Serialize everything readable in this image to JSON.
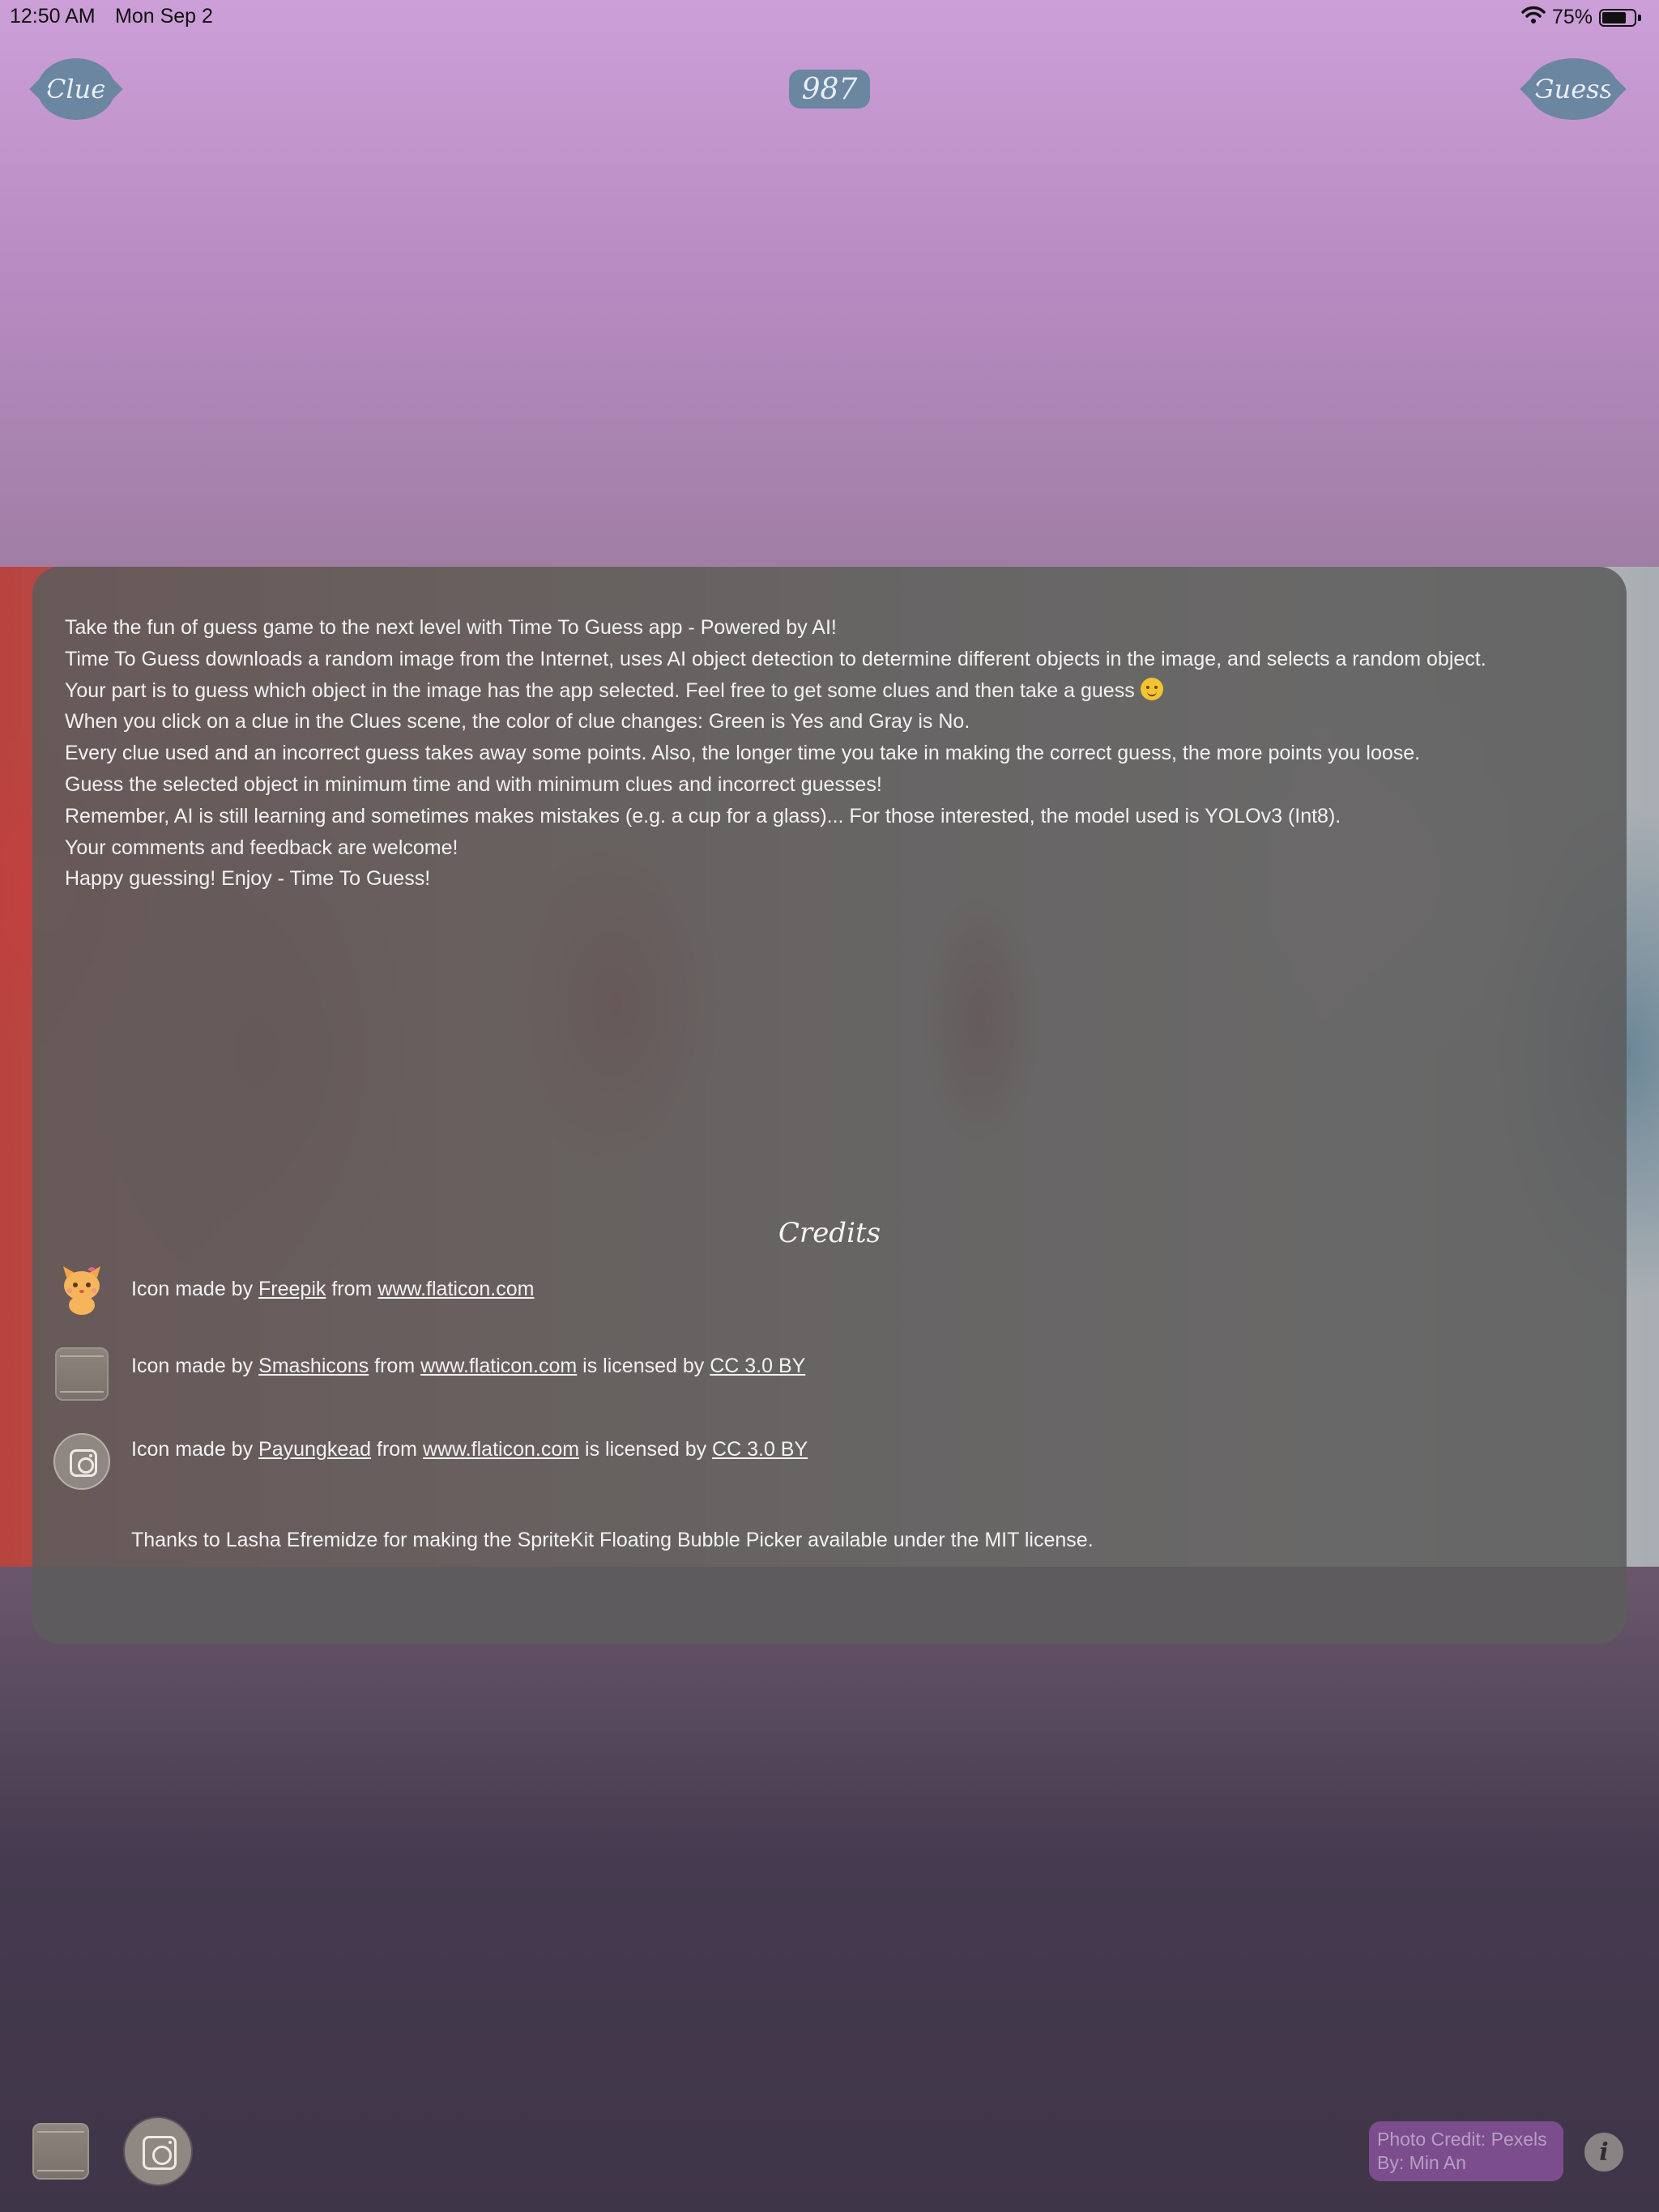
{
  "status_bar": {
    "time": "12:50 AM",
    "date": "Mon Sep 2",
    "battery": "75%",
    "battery_level": 0.75
  },
  "top_bar": {
    "clue_label": "Clue",
    "score": "987",
    "guess_label": "Guess"
  },
  "about": {
    "lines": [
      "Take the fun of guess game to the next level with Time To Guess app - Powered by AI!",
      "Time To Guess downloads a random image from the Internet, uses AI object detection to determine different objects in the image, and selects a random object.",
      "Your part is to guess which object in the image has the app selected. Feel free to get some clues and then take a guess",
      "When you click on a clue in the Clues scene, the color of clue changes: Green is Yes and Gray is No.",
      "Every clue used and an incorrect guess takes away some points. Also, the longer time you take in making the correct guess, the more points you loose.",
      "Guess the selected object in minimum time and with minimum clues and incorrect guesses!",
      "Remember, AI is still learning and sometimes makes mistakes (e.g. a cup for a glass)... For those interested, the model used is YOLOv3 (Int8).",
      "Your comments and feedback are welcome!",
      "Happy guessing! Enjoy - Time To Guess!"
    ]
  },
  "credits": {
    "title": "Credits",
    "row1": {
      "prefix": "Icon made by ",
      "author": "Freepik",
      "from": " from ",
      "site": "www.flaticon.com"
    },
    "row2": {
      "prefix": "Icon made by ",
      "author": "Smashicons",
      "from": " from ",
      "site": "www.flaticon.com",
      "licensed": " is licensed by ",
      "license": "CC 3.0 BY"
    },
    "row3": {
      "prefix": "Icon made by ",
      "author": "Payungkead",
      "from": " from ",
      "site": "www.flaticon.com",
      "licensed": " is licensed by ",
      "license": "CC 3.0 BY"
    },
    "thanks": "Thanks to Lasha Efremidze for making the SpriteKit Floating Bubble Picker available under the MIT license."
  },
  "footer": {
    "photo_credit_line1": "Photo Credit: Pexels",
    "photo_credit_line2": "By: Min An",
    "info_label": "i"
  },
  "icons": {
    "cat": "cat-icon",
    "box": "archive-box-icon",
    "instagram": "instagram-icon",
    "info": "info-icon",
    "wifi": "wifi-icon",
    "battery": "battery-icon"
  },
  "colors": {
    "button": "#6b86a0",
    "panel": "#5c5c5c",
    "photo_credit_bg": "#7b4d8c"
  }
}
